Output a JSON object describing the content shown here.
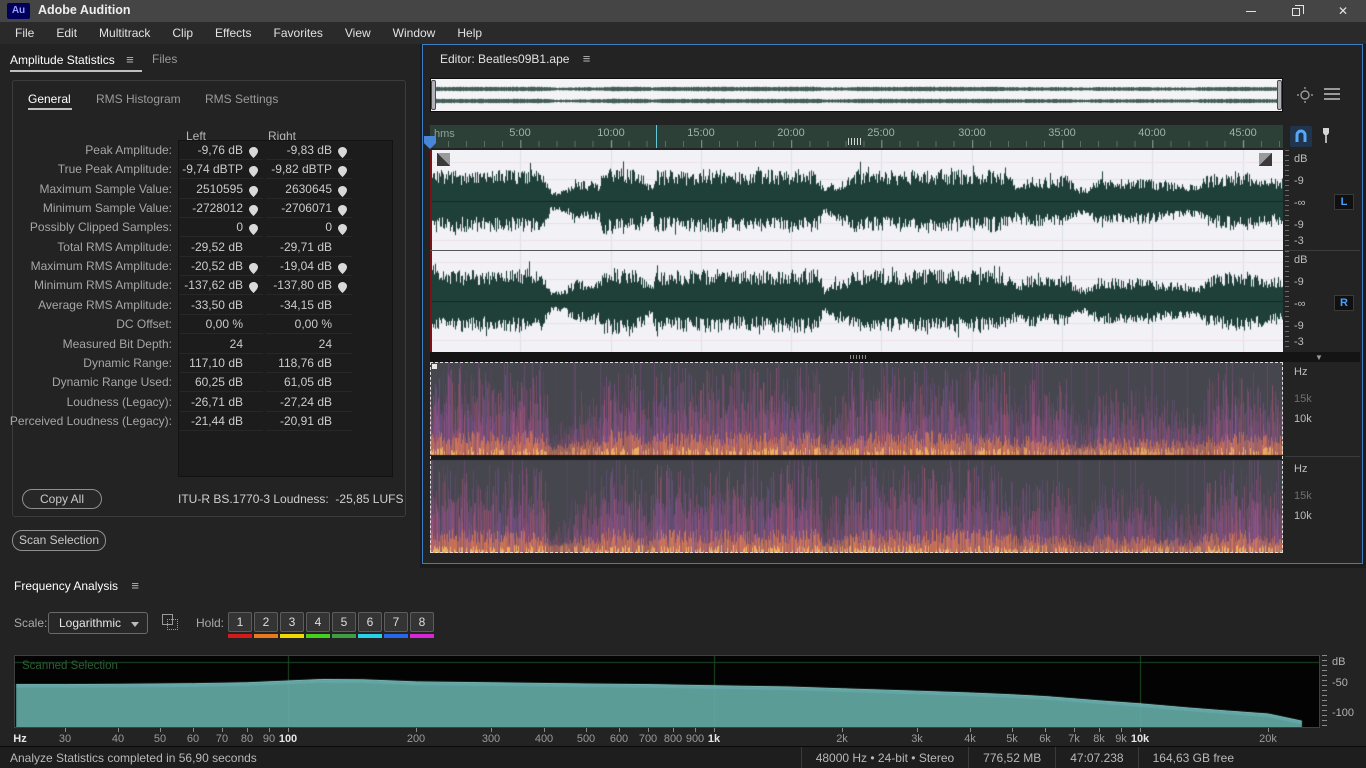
{
  "window": {
    "title": "Adobe Audition",
    "logo": "Au"
  },
  "menu": {
    "items": [
      "File",
      "Edit",
      "Multitrack",
      "Clip",
      "Effects",
      "Favorites",
      "View",
      "Window",
      "Help"
    ]
  },
  "stats_panel": {
    "tabs": [
      {
        "label": "Amplitude Statistics",
        "active": true
      },
      {
        "label": "Files",
        "active": false
      }
    ],
    "inner_tabs": [
      {
        "label": "General",
        "active": true
      },
      {
        "label": "RMS Histogram",
        "active": false
      },
      {
        "label": "RMS Settings",
        "active": false
      }
    ],
    "columns": [
      "Left",
      "Right"
    ],
    "rows": [
      {
        "label": "Peak Amplitude:",
        "left": "-9,76 dB",
        "right": "-9,83 dB",
        "pins": true
      },
      {
        "label": "True Peak Amplitude:",
        "left": "-9,74 dBTP",
        "right": "-9,82 dBTP",
        "pins": true
      },
      {
        "label": "Maximum Sample Value:",
        "left": "2510595",
        "right": "2630645",
        "pins": true
      },
      {
        "label": "Minimum Sample Value:",
        "left": "-2728012",
        "right": "-2706071",
        "pins": true
      },
      {
        "label": "Possibly Clipped Samples:",
        "left": "0",
        "right": "0",
        "pins": true
      },
      {
        "label": "Total RMS Amplitude:",
        "left": "-29,52 dB",
        "right": "-29,71 dB",
        "pins": false
      },
      {
        "label": "Maximum RMS Amplitude:",
        "left": "-20,52 dB",
        "right": "-19,04 dB",
        "pins": true
      },
      {
        "label": "Minimum RMS Amplitude:",
        "left": "-137,62 dB",
        "right": "-137,80 dB",
        "pins": true
      },
      {
        "label": "Average RMS Amplitude:",
        "left": "-33,50 dB",
        "right": "-34,15 dB",
        "pins": false
      },
      {
        "label": "DC Offset:",
        "left": "0,00 %",
        "right": "0,00 %",
        "pins": false
      },
      {
        "label": "Measured Bit Depth:",
        "left": "24",
        "right": "24",
        "pins": false
      },
      {
        "label": "Dynamic Range:",
        "left": "117,10 dB",
        "right": "118,76 dB",
        "pins": false
      },
      {
        "label": "Dynamic Range Used:",
        "left": "60,25 dB",
        "right": "61,05 dB",
        "pins": false
      },
      {
        "label": "Loudness (Legacy):",
        "left": "-26,71 dB",
        "right": "-27,24 dB",
        "pins": false
      },
      {
        "label": "Perceived Loudness (Legacy):",
        "left": "-21,44 dB",
        "right": "-20,91 dB",
        "pins": false
      }
    ],
    "copy_all_label": "Copy All",
    "loudness_label": "ITU-R BS.1770-3 Loudness:",
    "loudness_value": "-25,85 LUFS",
    "scan_selection_label": "Scan Selection"
  },
  "editor": {
    "title": "Editor: Beatles09B1.ape",
    "ruler": {
      "unit": "hms",
      "ticks": [
        "5:00",
        "10:00",
        "15:00",
        "20:00",
        "25:00",
        "30:00",
        "35:00",
        "40:00",
        "45:00"
      ]
    },
    "wave_scale": {
      "unit": "dB",
      "labels": [
        "-9",
        "-∞",
        "-9",
        "-3"
      ]
    },
    "spec_scale": {
      "unit": "Hz",
      "labels": [
        "15k",
        "10k"
      ]
    },
    "channels": [
      {
        "label": "L"
      },
      {
        "label": "R"
      }
    ],
    "waveform_envelope": [
      [
        0,
        0.72
      ],
      [
        3,
        0.7
      ],
      [
        5.5,
        0.74
      ],
      [
        6.3,
        0.68
      ],
      [
        6.7,
        0.22
      ],
      [
        7.6,
        0.3
      ],
      [
        8.0,
        0.5
      ],
      [
        9.3,
        0.45
      ],
      [
        9.6,
        0.78
      ],
      [
        11.5,
        0.72
      ],
      [
        12.2,
        0.4
      ],
      [
        12.5,
        0.72
      ],
      [
        14,
        0.7
      ],
      [
        16,
        0.74
      ],
      [
        17,
        0.68
      ],
      [
        19,
        0.72
      ],
      [
        21.4,
        0.75
      ],
      [
        21.8,
        0.3
      ],
      [
        22.3,
        0.45
      ],
      [
        23,
        0.5
      ],
      [
        23.5,
        0.72
      ],
      [
        26,
        0.7
      ],
      [
        28,
        0.74
      ],
      [
        30,
        0.7
      ],
      [
        31.5,
        0.72
      ],
      [
        32.6,
        0.45
      ],
      [
        33.2,
        0.6
      ],
      [
        34.2,
        0.55
      ],
      [
        35.2,
        0.6
      ],
      [
        35.8,
        0.35
      ],
      [
        36.3,
        0.3
      ],
      [
        37,
        0.55
      ],
      [
        38.5,
        0.5
      ],
      [
        39.5,
        0.55
      ],
      [
        40.5,
        0.45
      ],
      [
        41.5,
        0.42
      ],
      [
        42.5,
        0.35
      ],
      [
        43,
        0.6
      ],
      [
        44,
        0.65
      ],
      [
        45,
        0.7
      ],
      [
        46,
        0.6
      ],
      [
        47,
        0.55
      ]
    ]
  },
  "freq_panel": {
    "title": "Frequency Analysis",
    "scale_label": "Scale:",
    "scale_value": "Logarithmic",
    "hold_label": "Hold:",
    "hold_buttons": [
      {
        "label": "1",
        "color": "#d41a1a"
      },
      {
        "label": "2",
        "color": "#e8791e"
      },
      {
        "label": "3",
        "color": "#f0d800"
      },
      {
        "label": "4",
        "color": "#46d01e"
      },
      {
        "label": "5",
        "color": "#3f9e3f"
      },
      {
        "label": "6",
        "color": "#28d0e8"
      },
      {
        "label": "7",
        "color": "#2868e8"
      },
      {
        "label": "8",
        "color": "#d428d4"
      }
    ],
    "axis_unit": "Hz"
  },
  "status_bar": {
    "left": "Analyze Statistics completed in 56,90 seconds",
    "segments": [
      "48000 Hz • 24-bit • Stereo",
      "776,52 MB",
      "47:07.238",
      "164,63 GB free"
    ]
  },
  "chart_data": {
    "type": "area",
    "title": "Frequency Analysis",
    "overlay_label": "Scanned Selection",
    "xlabel": "Hz",
    "ylabel": "dB",
    "x_scale": "logarithmic",
    "xlim": [
      23,
      26000
    ],
    "ylim": [
      -125,
      0
    ],
    "grid": "green decade lines",
    "x_ticks": [
      {
        "label": "30",
        "f": 30,
        "major": false
      },
      {
        "label": "40",
        "f": 40,
        "major": false
      },
      {
        "label": "50",
        "f": 50,
        "major": false
      },
      {
        "label": "60",
        "f": 60,
        "major": false
      },
      {
        "label": "70",
        "f": 70,
        "major": false
      },
      {
        "label": "80",
        "f": 80,
        "major": false
      },
      {
        "label": "90",
        "f": 90,
        "major": false
      },
      {
        "label": "100",
        "f": 100,
        "major": true
      },
      {
        "label": "200",
        "f": 200,
        "major": false
      },
      {
        "label": "300",
        "f": 300,
        "major": false
      },
      {
        "label": "400",
        "f": 400,
        "major": false
      },
      {
        "label": "500",
        "f": 500,
        "major": false
      },
      {
        "label": "600",
        "f": 600,
        "major": false
      },
      {
        "label": "700",
        "f": 700,
        "major": false
      },
      {
        "label": "800",
        "f": 800,
        "major": false
      },
      {
        "label": "900",
        "f": 900,
        "major": false
      },
      {
        "label": "1k",
        "f": 1000,
        "major": true
      },
      {
        "label": "2k",
        "f": 2000,
        "major": false
      },
      {
        "label": "3k",
        "f": 3000,
        "major": false
      },
      {
        "label": "4k",
        "f": 4000,
        "major": false
      },
      {
        "label": "5k",
        "f": 5000,
        "major": false
      },
      {
        "label": "6k",
        "f": 6000,
        "major": false
      },
      {
        "label": "7k",
        "f": 7000,
        "major": false
      },
      {
        "label": "8k",
        "f": 8000,
        "major": false
      },
      {
        "label": "9k",
        "f": 9000,
        "major": false
      },
      {
        "label": "10k",
        "f": 10000,
        "major": true
      },
      {
        "label": "20k",
        "f": 20000,
        "major": false
      }
    ],
    "y_ticks": [
      {
        "label": "dB",
        "db": 0
      },
      {
        "label": "-50",
        "db": -50
      },
      {
        "label": "-100",
        "db": -100
      }
    ],
    "gridlines_x_hz": [
      100,
      1000,
      10000
    ],
    "gridline_y_db": -13,
    "series": [
      {
        "name": "Scanned Selection",
        "x": [
          23,
          30,
          40,
          60,
          80,
          100,
          120,
          150,
          200,
          300,
          500,
          700,
          1000,
          1500,
          2000,
          3000,
          4000,
          5000,
          6000,
          8000,
          10000,
          13000,
          16000,
          20000,
          24000
        ],
        "y": [
          -51,
          -51,
          -50.5,
          -49.5,
          -48,
          -45,
          -42.5,
          -43,
          -46.5,
          -48,
          -50,
          -51,
          -53,
          -55,
          -58,
          -62,
          -65,
          -68,
          -71,
          -78,
          -83,
          -90,
          -95,
          -100,
          -112
        ]
      }
    ]
  },
  "colors": {
    "accent_blue": "#3e7dc4",
    "waveform": "#1f4038",
    "waveform_bg": "#f1f1f6",
    "grid_v": "#dde1e9",
    "grid_h": "#e6e2ea",
    "grid_h2": "#f0e2e6",
    "ruler_bg": "#2d4038",
    "spectro_bg": "#46464e",
    "spectro_purple": [
      "#7d59a8",
      "#9a55a0",
      "#b75390",
      "#cc5b7e"
    ],
    "spectro_orange": [
      "#e4814e",
      "#f7b963"
    ],
    "overview_wave": "#23423b",
    "freq_fill": "#68b2ac",
    "freq_edge": "#8fd2ca",
    "freq_blue": "#4f6fc0",
    "grid_green": "#1c4a22",
    "playhead_red": "#7c1212",
    "playhead_blue": "#4a86d8",
    "channel_blue": "#4a9eff"
  }
}
